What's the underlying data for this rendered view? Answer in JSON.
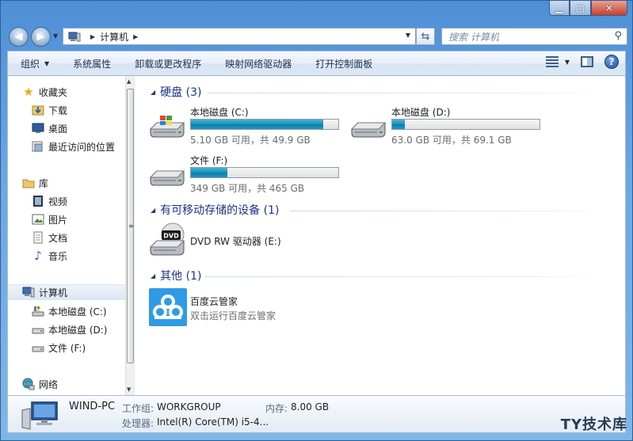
{
  "window": {
    "caption_buttons": {
      "minimize": "▁",
      "maximize": "□",
      "close": "✕"
    }
  },
  "address": {
    "crumb": "计算机",
    "search_placeholder": "搜索 计算机"
  },
  "toolbar": {
    "organize": "组织",
    "system_properties": "系统属性",
    "uninstall": "卸载或更改程序",
    "map_drive": "映射网络驱动器",
    "control_panel": "打开控制面板",
    "help": "?"
  },
  "sidebar": {
    "favorites": {
      "label": "收藏夹",
      "items": [
        {
          "label": "下载"
        },
        {
          "label": "桌面"
        },
        {
          "label": "最近访问的位置"
        }
      ]
    },
    "libraries": {
      "label": "库",
      "items": [
        {
          "label": "视频"
        },
        {
          "label": "图片"
        },
        {
          "label": "文档"
        },
        {
          "label": "音乐"
        }
      ]
    },
    "computer": {
      "label": "计算机",
      "items": [
        {
          "label": "本地磁盘 (C:)"
        },
        {
          "label": "本地磁盘 (D:)"
        },
        {
          "label": "文件 (F:)"
        }
      ]
    },
    "network": {
      "label": "网络"
    }
  },
  "groups": {
    "hdd": {
      "title": "硬盘 (3)"
    },
    "removable": {
      "title": "有可移动存储的设备 (1)"
    },
    "other": {
      "title": "其他 (1)"
    }
  },
  "drives": [
    {
      "name": "本地磁盘 (C:)",
      "info": "5.10 GB 可用，共 49.9 GB",
      "used_fraction": 0.898
    },
    {
      "name": "本地磁盘 (D:)",
      "info": "63.0 GB 可用，共 69.1 GB",
      "used_fraction": 0.088
    },
    {
      "name": "文件 (F:)",
      "info": "349 GB 可用，共 465 GB",
      "used_fraction": 0.249
    }
  ],
  "dvd": {
    "name": "DVD RW 驱动器 (E:)",
    "icon_text": "DVD"
  },
  "other_item": {
    "name": "百度云管家",
    "sub": "双击运行百度云管家"
  },
  "details": {
    "pc_name": "WIND-PC",
    "workgroup_label": "工作组:",
    "workgroup": "WORKGROUP",
    "memory_label": "内存:",
    "memory": "8.00 GB",
    "cpu_label": "处理器:",
    "cpu": "Intel(R) Core(TM) i5-4..."
  },
  "watermark": "TY技术库",
  "colors": {
    "accent": "#1e3287",
    "bar_fill": "#1b94bd"
  }
}
